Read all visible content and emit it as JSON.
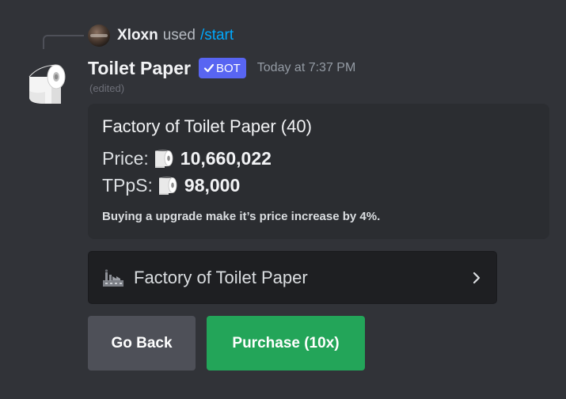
{
  "command_reply": {
    "user": "Xloxn",
    "used_text": "used",
    "command": "/start"
  },
  "message": {
    "author": "Toilet Paper",
    "bot_tag": "BOT",
    "timestamp": "Today at 7:37 PM",
    "edited": "(edited)"
  },
  "embed": {
    "title": "Factory of Toilet Paper (40)",
    "price_label": "Price:",
    "price_value": "10,660,022",
    "tpps_label": "TPpS:",
    "tpps_value": "98,000",
    "note": "Buying a upgrade make it’s price increase by 4%."
  },
  "select_menu": {
    "icon": "factory-icon",
    "selected": "Factory of Toilet Paper"
  },
  "buttons": {
    "back": "Go Back",
    "purchase": "Purchase (10x)"
  },
  "colors": {
    "background": "#313338",
    "embed_bg": "#2b2d31",
    "select_bg": "#1e1f22",
    "bot_tag": "#5865f2",
    "command_link": "#00a8fc",
    "secondary_button": "#4e5058",
    "success_button": "#23a559"
  }
}
